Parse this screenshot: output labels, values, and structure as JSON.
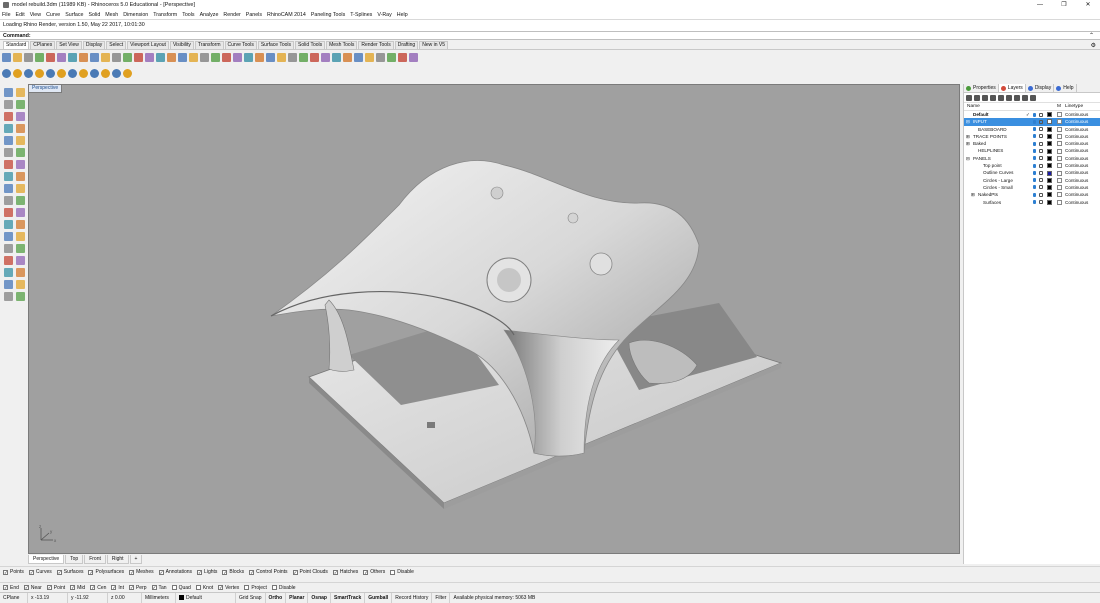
{
  "window": {
    "title": "model rebuild.3dm (11989 KB) - Rhinoceros 5.0 Educational - [Perspective]",
    "controls": [
      "—",
      "❐",
      "✕"
    ]
  },
  "menu": [
    "File",
    "Edit",
    "View",
    "Curve",
    "Surface",
    "Solid",
    "Mesh",
    "Dimension",
    "Transform",
    "Tools",
    "Analyze",
    "Render",
    "Panels",
    "RhinoCAM 2014",
    "Paneling Tools",
    "T-Splines",
    "V-Ray",
    "Help"
  ],
  "command_history": "Loading Rhino Render, version 1.50, May 22 2017, 10:01:30",
  "command": {
    "label": "Command:",
    "value": ""
  },
  "toolbar_tabs": [
    "Standard",
    "CPlanes",
    "Set View",
    "Display",
    "Select",
    "Viewport Layout",
    "Visibility",
    "Transform",
    "Curve Tools",
    "Surface Tools",
    "Solid Tools",
    "Mesh Tools",
    "Render Tools",
    "Drafting",
    "New in V5"
  ],
  "toolbar_active": "Standard",
  "viewport": {
    "title": "Perspective",
    "tabs": [
      "Perspective",
      "Top",
      "Front",
      "Right"
    ],
    "add_tab": "+",
    "bg_color": "#a0a0a0"
  },
  "filters": [
    {
      "label": "Points",
      "checked": true
    },
    {
      "label": "Curves",
      "checked": true
    },
    {
      "label": "Surfaces",
      "checked": true
    },
    {
      "label": "Polysurfaces",
      "checked": true
    },
    {
      "label": "Meshes",
      "checked": true
    },
    {
      "label": "Annotations",
      "checked": true
    },
    {
      "label": "Lights",
      "checked": true
    },
    {
      "label": "Blocks",
      "checked": true
    },
    {
      "label": "Control Points",
      "checked": true
    },
    {
      "label": "Point Clouds",
      "checked": true
    },
    {
      "label": "Hatches",
      "checked": true
    },
    {
      "label": "Others",
      "checked": true
    },
    {
      "label": "Disable",
      "checked": false
    }
  ],
  "osnaps": [
    {
      "label": "End",
      "checked": true
    },
    {
      "label": "Near",
      "checked": true
    },
    {
      "label": "Point",
      "checked": true
    },
    {
      "label": "Mid",
      "checked": true
    },
    {
      "label": "Cen",
      "checked": true
    },
    {
      "label": "Int",
      "checked": true
    },
    {
      "label": "Perp",
      "checked": true
    },
    {
      "label": "Tan",
      "checked": true
    },
    {
      "label": "Quad",
      "checked": false
    },
    {
      "label": "Knot",
      "checked": false
    },
    {
      "label": "Vertex",
      "checked": true
    },
    {
      "label": "Project",
      "checked": false
    },
    {
      "label": "Disable",
      "checked": false
    }
  ],
  "status": {
    "cplane": "CPlane",
    "x": "x -13.19",
    "y": "y -11.92",
    "z": "z 0.00",
    "units": "Millimeters",
    "layer": "Default",
    "toggles": [
      "Grid Snap",
      "Ortho",
      "Planar",
      "Osnap",
      "SmartTrack",
      "Gumball",
      "Record History",
      "Filter"
    ],
    "bold_toggles": [
      "Ortho",
      "Planar",
      "Osnap",
      "SmartTrack",
      "Gumball"
    ],
    "memory": "Available physical memory: 5063 MB"
  },
  "panel": {
    "tabs": [
      {
        "label": "Properties",
        "color": "#4a9a3a"
      },
      {
        "label": "Layers",
        "color": "#d24a3a"
      },
      {
        "label": "Display",
        "color": "#3a6ad2"
      },
      {
        "label": "Help",
        "color": "#3a6ad2"
      }
    ],
    "active_tab": "Layers",
    "headers": {
      "name": "Name",
      "material": "M",
      "linetype": "Linetype"
    },
    "layers": [
      {
        "name": "Default",
        "indent": 0,
        "current": true,
        "selected": false,
        "bold": true,
        "expander": "",
        "color": "#000000",
        "linetype": "Continuous"
      },
      {
        "name": "INPUT",
        "indent": 0,
        "current": false,
        "selected": true,
        "bold": false,
        "expander": "⊟",
        "color": "#ffffff",
        "linetype": "Continuous"
      },
      {
        "name": "BASEBOARD",
        "indent": 1,
        "current": false,
        "selected": false,
        "bold": false,
        "expander": "",
        "color": "#000000",
        "linetype": "Continuous"
      },
      {
        "name": "TRACE POINTS",
        "indent": 0,
        "current": false,
        "selected": false,
        "bold": false,
        "expander": "⊞",
        "color": "#000000",
        "linetype": "Continuous"
      },
      {
        "name": "Baked",
        "indent": 0,
        "current": false,
        "selected": false,
        "bold": false,
        "expander": "⊞",
        "color": "#000000",
        "linetype": "Continuous"
      },
      {
        "name": "HELPLINES",
        "indent": 1,
        "current": false,
        "selected": false,
        "bold": false,
        "expander": "",
        "color": "#000000",
        "linetype": "Continuous"
      },
      {
        "name": "PANELS",
        "indent": 0,
        "current": false,
        "selected": false,
        "bold": false,
        "expander": "⊟",
        "color": "#000000",
        "linetype": "Continuous"
      },
      {
        "name": "Top point",
        "indent": 2,
        "current": false,
        "selected": false,
        "bold": false,
        "expander": "",
        "color": "#000000",
        "linetype": "Continuous"
      },
      {
        "name": "Outline Curves",
        "indent": 2,
        "current": false,
        "selected": false,
        "bold": false,
        "expander": "",
        "color": "#1a1aa8",
        "linetype": "Continuous"
      },
      {
        "name": "Circles - Large",
        "indent": 2,
        "current": false,
        "selected": false,
        "bold": false,
        "expander": "",
        "color": "#000000",
        "linetype": "Continuous"
      },
      {
        "name": "Circles - Small",
        "indent": 2,
        "current": false,
        "selected": false,
        "bold": false,
        "expander": "",
        "color": "#000000",
        "linetype": "Continuous"
      },
      {
        "name": "NakedPts",
        "indent": 1,
        "current": false,
        "selected": false,
        "bold": false,
        "expander": "⊞",
        "color": "#000000",
        "linetype": "Continuous"
      },
      {
        "name": "Surfaces",
        "indent": 2,
        "current": false,
        "selected": false,
        "bold": false,
        "expander": "",
        "color": "#000000",
        "linetype": "Continuous"
      }
    ]
  },
  "axis_labels": {
    "z": "z",
    "y": "y",
    "x": "x"
  }
}
